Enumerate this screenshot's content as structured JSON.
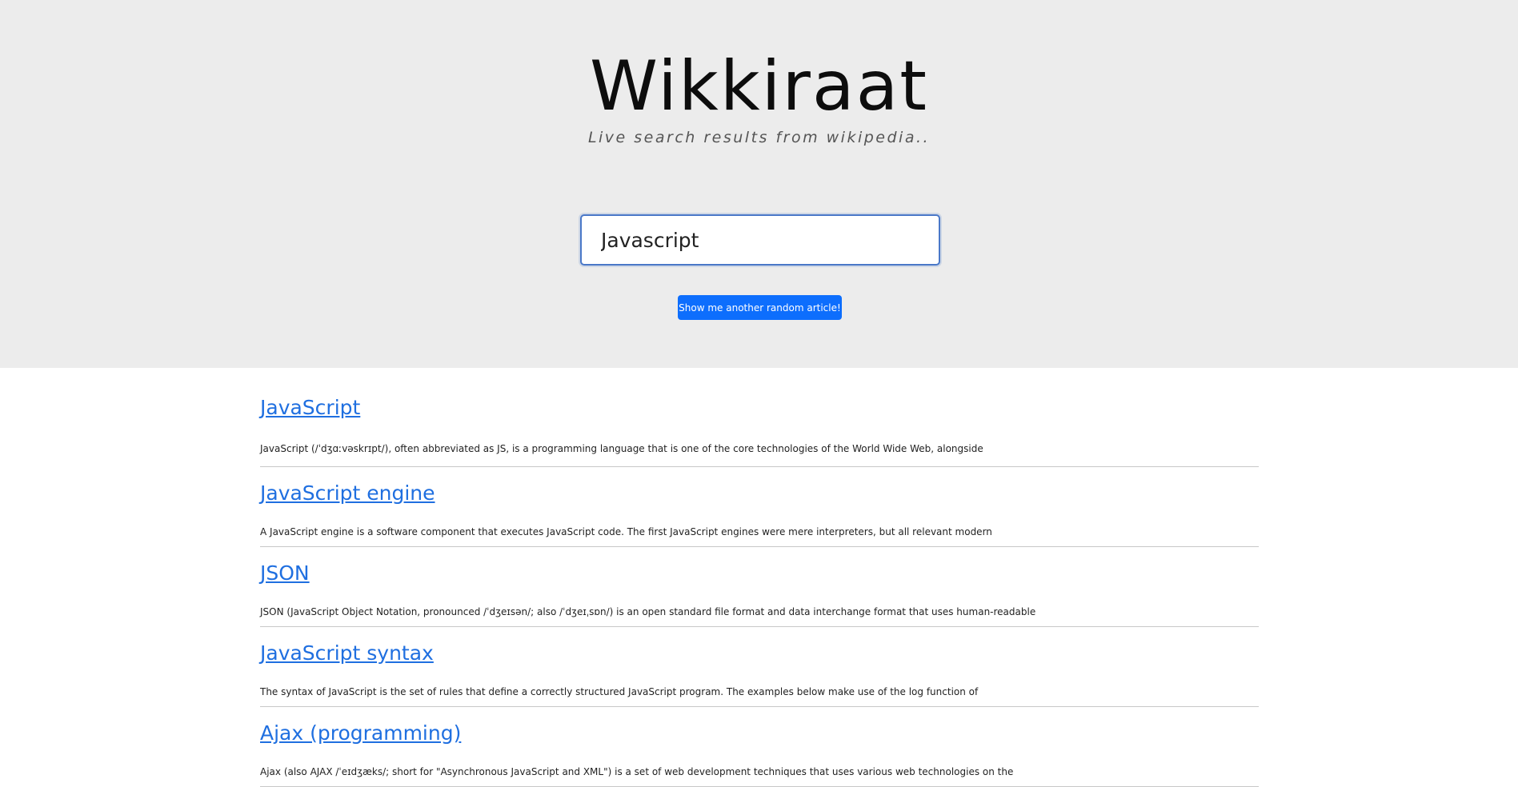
{
  "header": {
    "title": "Wikkiraat",
    "tagline": "Live search results from wikipedia.."
  },
  "search": {
    "value": "Javascript",
    "placeholder": ""
  },
  "random_button": {
    "label": "Show me another random article!"
  },
  "colors": {
    "hero_background": "#ececec",
    "button": "#0d6efd",
    "link": "#1f6fe0"
  },
  "results": [
    {
      "title": "JavaScript",
      "snippet": "JavaScript (/ˈdʒɑːvəskrɪpt/), often abbreviated as JS, is a programming language that is one of the core technologies of the World Wide Web, alongside"
    },
    {
      "title": "JavaScript engine",
      "snippet": "A JavaScript engine is a software component that executes JavaScript code. The first JavaScript engines were mere interpreters, but all relevant modern"
    },
    {
      "title": "JSON",
      "snippet": "JSON (JavaScript Object Notation, pronounced /ˈdʒeɪsən/; also /ˈdʒeɪˌsɒn/) is an open standard file format and data interchange format that uses human-readable"
    },
    {
      "title": "JavaScript syntax",
      "snippet": "The syntax of JavaScript is the set of rules that define a correctly structured JavaScript program. The examples below make use of the log function of"
    },
    {
      "title": "Ajax (programming)",
      "snippet": "Ajax (also AJAX /ˈeɪdʒæks/; short for \"Asynchronous JavaScript and XML\") is a set of web development techniques that uses various web technologies on the"
    }
  ]
}
